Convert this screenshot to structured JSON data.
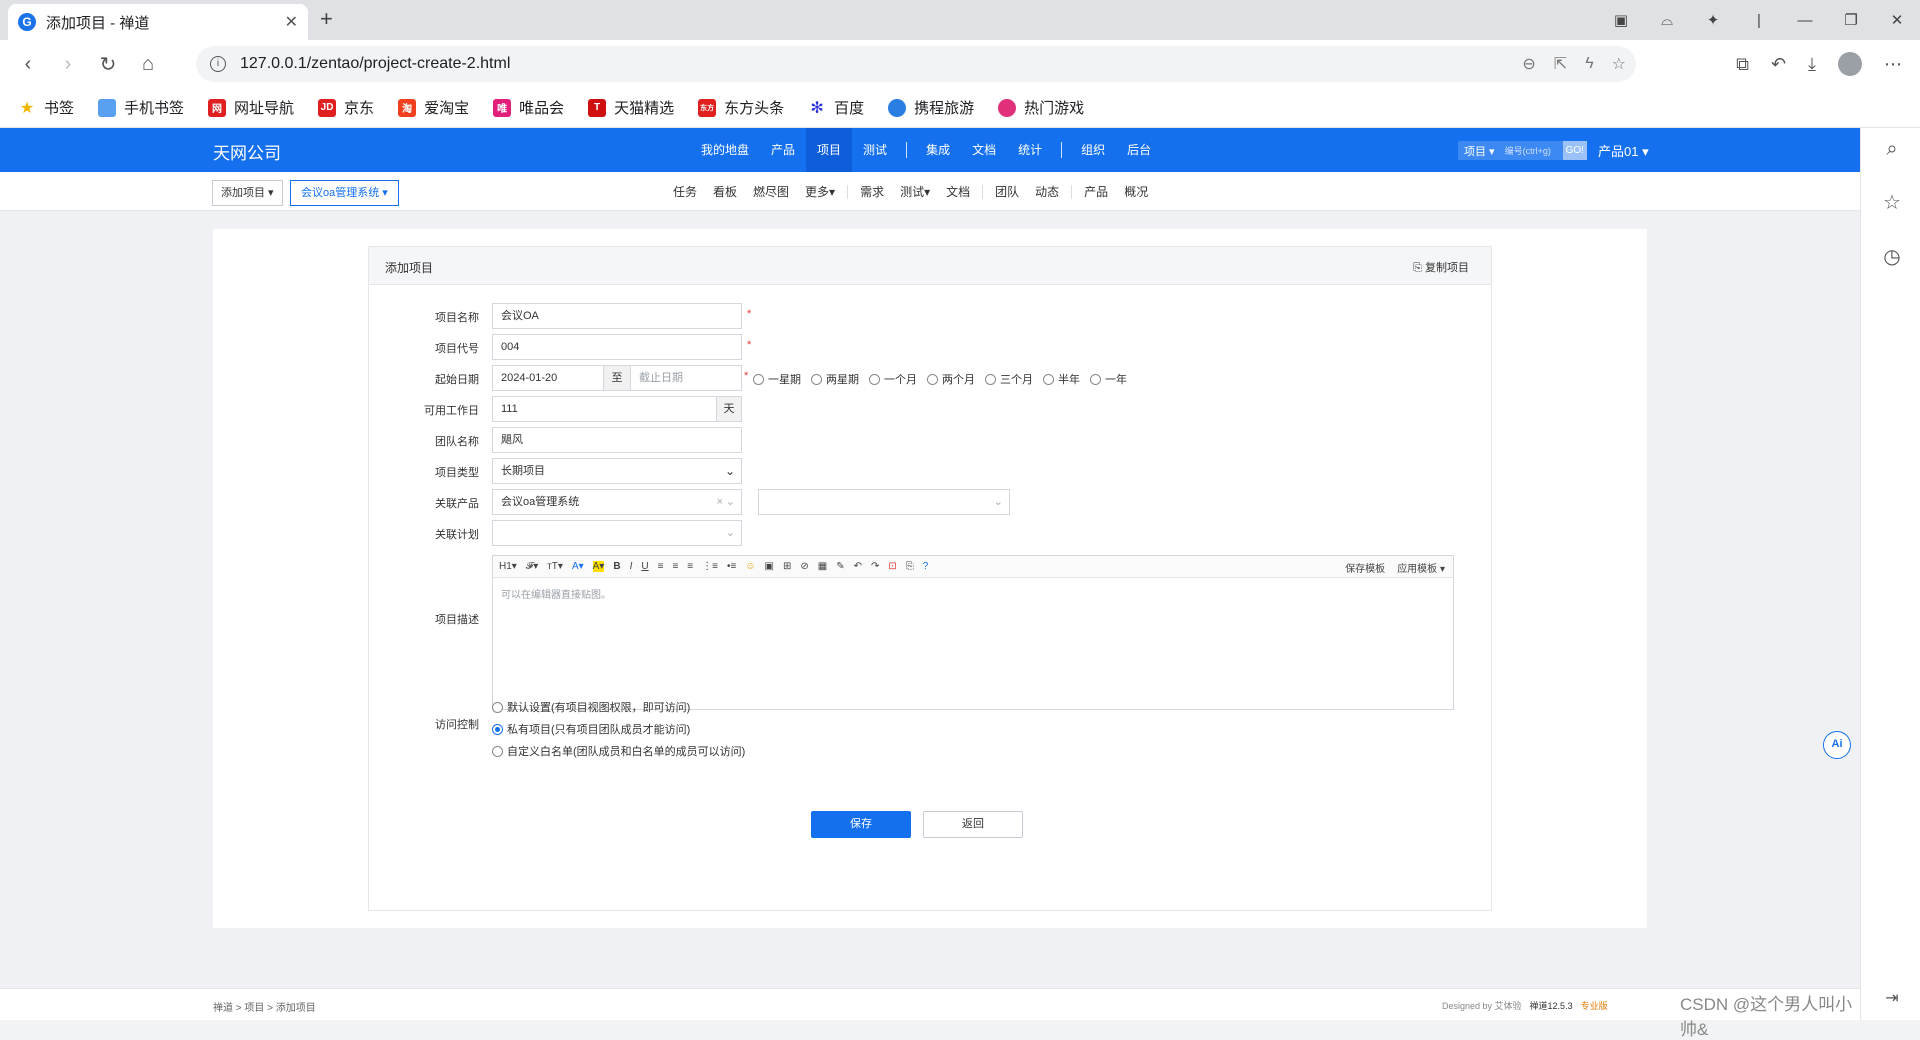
{
  "browser": {
    "tab_title": "添加项目 - 禅道",
    "url": "127.0.0.1/zentao/project-create-2.html",
    "bookmarks": [
      "书签",
      "手机书签",
      "网址导航",
      "京东",
      "爱淘宝",
      "唯品会",
      "天猫精选",
      "东方头条",
      "百度",
      "携程旅游",
      "热门游戏"
    ]
  },
  "app": {
    "company": "天网公司",
    "main_menu": [
      "我的地盘",
      "产品",
      "项目",
      "测试",
      "集成",
      "文档",
      "统计",
      "组织",
      "后台"
    ],
    "active_menu": "项目",
    "search": {
      "type": "项目 ▾",
      "placeholder": "编号(ctrl+g)",
      "go": "GO!"
    },
    "product_switch": "产品01 ▾",
    "breadcrumb": {
      "first": "添加项目 ▾",
      "second": "会议oa管理系统 ▾"
    },
    "sub_menu": [
      "任务",
      "看板",
      "燃尽图",
      "更多▾",
      "需求",
      "测试▾",
      "文档",
      "团队",
      "动态",
      "产品",
      "概况"
    ]
  },
  "form": {
    "title": "添加项目",
    "copy_label": "复制项目",
    "name_label": "项目名称",
    "name_value": "会议OA",
    "code_label": "项目代号",
    "code_value": "004",
    "date_label": "起始日期",
    "begin_date": "2024-01-20",
    "date_sep": "至",
    "end_placeholder": "截止日期",
    "durations": [
      "一星期",
      "两星期",
      "一个月",
      "两个月",
      "三个月",
      "半年",
      "一年"
    ],
    "days_label": "可用工作日",
    "days_value": "111",
    "days_unit": "天",
    "team_label": "团队名称",
    "team_value": "飓风",
    "type_label": "项目类型",
    "type_value": "长期项目",
    "product_label": "关联产品",
    "product_value": "会议oa管理系统",
    "plan_label": "关联计划",
    "desc_label": "项目描述",
    "editor_tools": [
      "H1▾",
      "𝓕▾",
      "тT▾",
      "A▾",
      "A▾",
      "B",
      "I",
      "U",
      "≡",
      "≡",
      "≡",
      "⋮≡",
      "•≡",
      "☺",
      "▣",
      "⊞",
      "⊘",
      "▦",
      "✎",
      "↶",
      "↷",
      "⊡",
      "⎘",
      "?"
    ],
    "editor_save_tpl": "保存模板",
    "editor_apply_tpl": "应用模板 ▾",
    "editor_placeholder": "可以在编辑器直接贴图。",
    "acl_label": "访问控制",
    "acl_options": [
      "默认设置(有项目视图权限，即可访问)",
      "私有项目(只有项目团队成员才能访问)",
      "自定义白名单(团队成员和白名单的成员可以访问)"
    ],
    "acl_selected": 1,
    "save": "保存",
    "back": "返回"
  },
  "footer": {
    "crumb": "禅道 > 项目 > 添加项目",
    "designed": "Designed by 艾体验",
    "version": "禅道12.5.3",
    "edition": "专业版",
    "watermark": "CSDN @这个男人叫小帅&"
  }
}
